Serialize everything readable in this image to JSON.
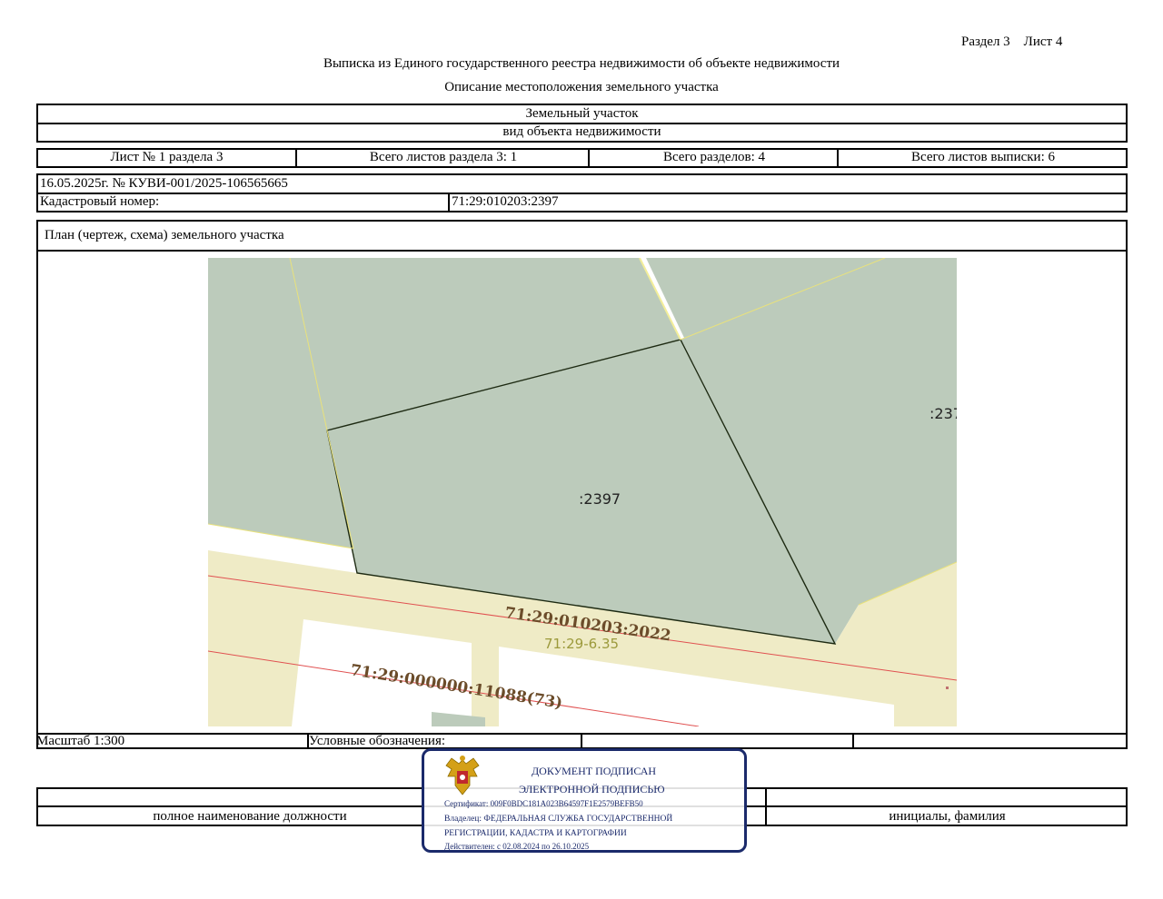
{
  "header": {
    "section_sheet": "Раздел 3    Лист 4",
    "title": "Выписка из Единого государственного реестра недвижимости об объекте недвижимости",
    "subtitle": "Описание местоположения земельного участка"
  },
  "object": {
    "type": "Земельный участок",
    "type_caption": "вид объекта недвижимости"
  },
  "sheet_info": {
    "sheet": "Лист № 1 раздела 3",
    "total_sheets_section": "Всего листов раздела 3: 1",
    "total_sections": "Всего разделов: 4",
    "total_sheets_extract": "Всего листов выписки: 6"
  },
  "record": {
    "date_number": "16.05.2025г. № КУВИ-001/2025-106565665",
    "cadastral_label": "Кадастровый номер:",
    "cadastral_value": "71:29:010203:2397"
  },
  "plan": {
    "title": "План (чертеж, схема) земельного участка",
    "labels": {
      "parcel": ":2397",
      "neighbor": ":237",
      "road_parcel": "71:29:010203:2022",
      "zone": "71:29-6.35",
      "road_main": "71:29:000000:11088(73)"
    },
    "colors": {
      "parcel_fill": "#bccbbb",
      "road_fill": "#efebc6",
      "boundary_yellow": "#e9e27c",
      "red_line": "#e05050",
      "label_brown": "#6b4c2a",
      "zone_label": "#9c9a3c"
    }
  },
  "footer": {
    "scale": "Масштаб 1:300",
    "legend": "Условные обозначения:",
    "position_caption": "полное наименование должности",
    "name_caption": "инициалы, фамилия"
  },
  "stamp": {
    "line1": "ДОКУМЕНТ ПОДПИСАН",
    "line2": "ЭЛЕКТРОННОЙ ПОДПИСЬЮ",
    "certificate": "Сертификат: 009F0BDC181A023B64597F1E2579BEFB50",
    "owner_line1": "Владелец: ФЕДЕРАЛЬНАЯ СЛУЖБА ГОСУДАРСТВЕННОЙ",
    "owner_line2": "РЕГИСТРАЦИИ, КАДАСТРА И КАРТОГРАФИИ",
    "valid": "Действителен: с 02.08.2024 по 26.10.2025",
    "emblem": "russian-eagle-emblem",
    "color": "#1b2a6b"
  }
}
